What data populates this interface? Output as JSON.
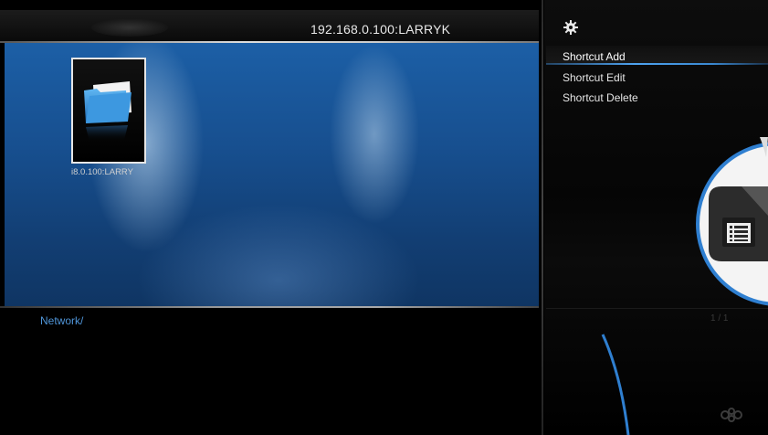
{
  "header": {
    "title": "192.168.0.100:LARRYK"
  },
  "browse": {
    "items": [
      {
        "label": "i8.0.100:LARRY",
        "icon": "folder-icon"
      }
    ],
    "path": "Network/"
  },
  "menu": {
    "icon": "gear-icon",
    "items": [
      {
        "label": "Shortcut Add",
        "selected": true
      },
      {
        "label": "Shortcut Edit",
        "selected": false
      },
      {
        "label": "Shortcut Delete",
        "selected": false
      }
    ],
    "page_counter": "1 / 1"
  },
  "callout": {
    "icon": "list-document-icon"
  },
  "colors": {
    "accent": "#2f7fd0",
    "panel": "#174f8f",
    "path_text": "#4f95d8"
  }
}
